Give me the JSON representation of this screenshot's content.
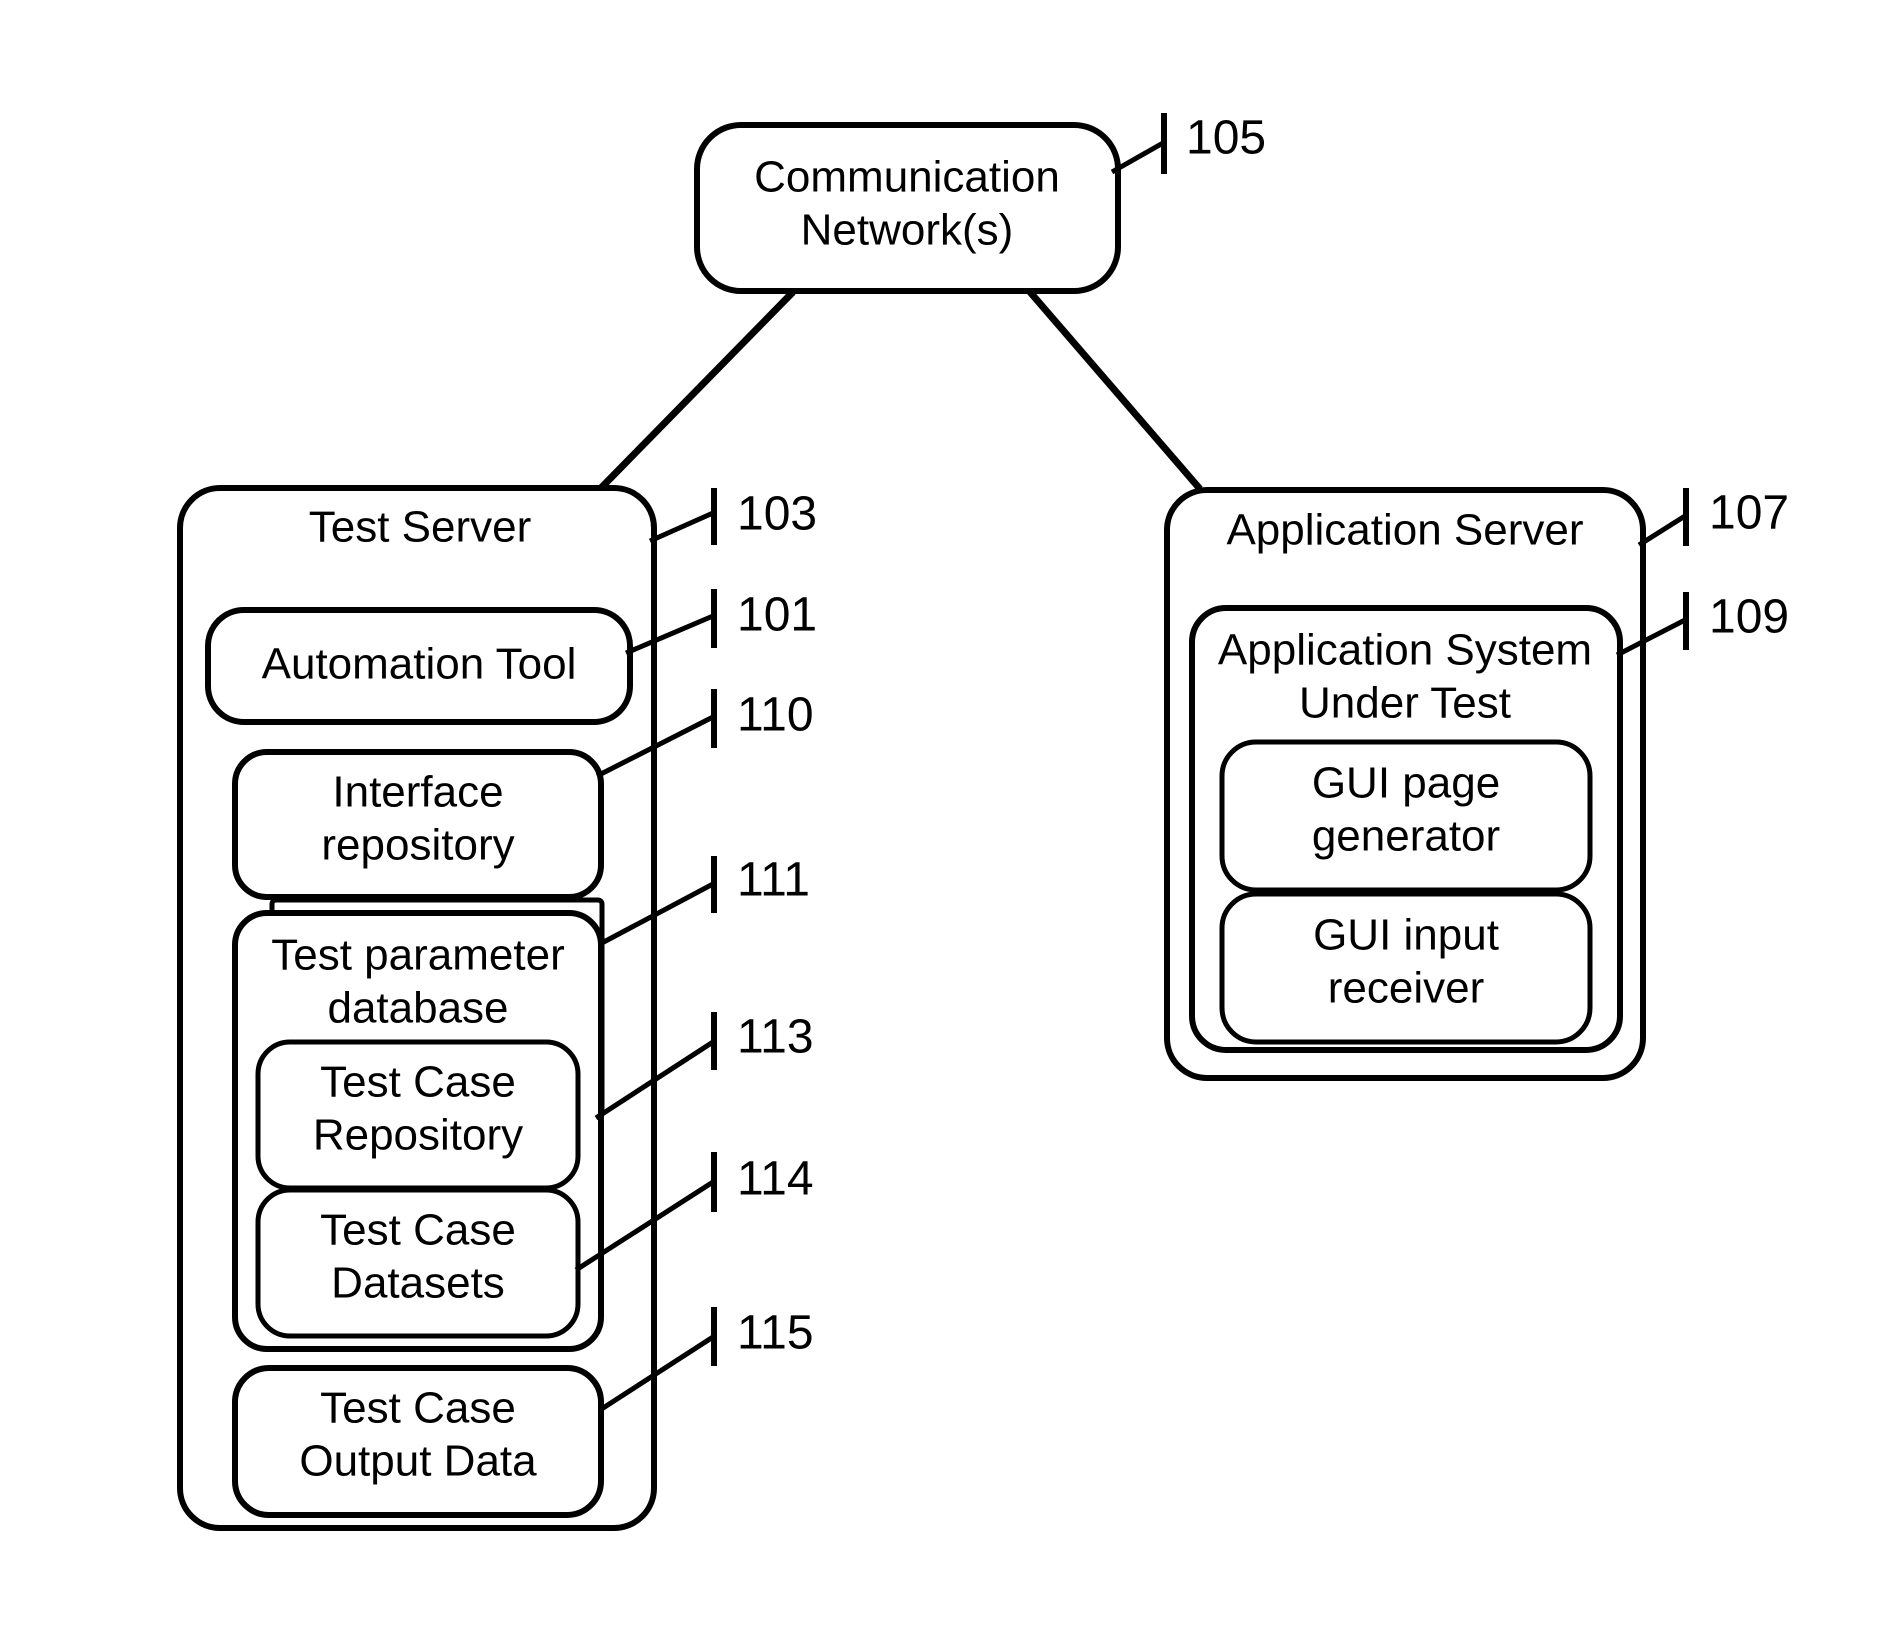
{
  "figure": {
    "type": "patent-block-diagram",
    "background_color": "#ffffff",
    "line_color": "#000000"
  },
  "nodes": {
    "communication_network": {
      "label_line1": "Communication",
      "label_line2": "Network(s)"
    },
    "test_server": {
      "label": "Test Server"
    },
    "automation_tool": {
      "label": "Automation Tool"
    },
    "interface_repository": {
      "label_line1": "Interface",
      "label_line2": "repository"
    },
    "test_parameter_database": {
      "label_line1": "Test parameter",
      "label_line2": "database"
    },
    "test_case_repository": {
      "label_line1": "Test Case",
      "label_line2": "Repository"
    },
    "test_case_datasets": {
      "label_line1": "Test Case",
      "label_line2": "Datasets"
    },
    "test_case_output_data": {
      "label_line1": "Test Case",
      "label_line2": "Output Data"
    },
    "application_server": {
      "label": "Application Server"
    },
    "application_system_under_test": {
      "label_line1": "Application System",
      "label_line2": "Under Test"
    },
    "gui_page_generator": {
      "label_line1": "GUI page",
      "label_line2": "generator"
    },
    "gui_input_receiver": {
      "label_line1": "GUI input",
      "label_line2": "receiver"
    }
  },
  "reference_numerals": {
    "communication_network": "105",
    "test_server": "103",
    "automation_tool": "101",
    "interface_repository": "110",
    "test_parameter_database": "111",
    "test_case_repository": "113",
    "test_case_datasets": "114",
    "test_case_output_data": "115",
    "application_server": "107",
    "application_system_under_test": "109"
  }
}
